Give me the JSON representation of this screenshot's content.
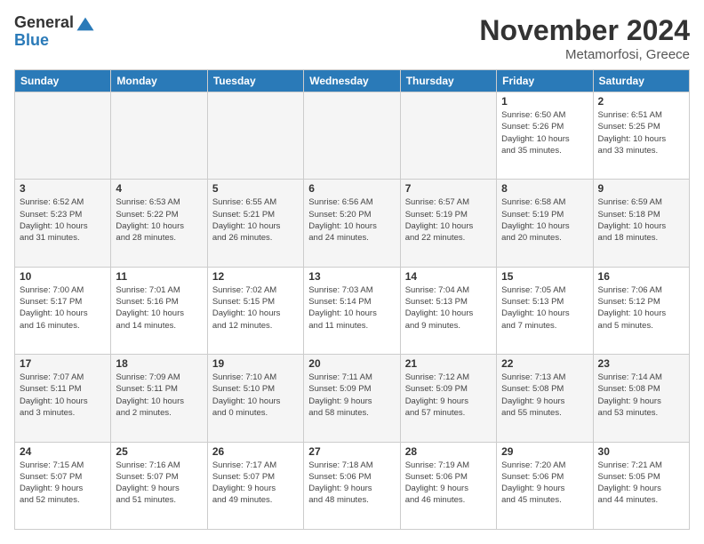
{
  "logo": {
    "general": "General",
    "blue": "Blue"
  },
  "header": {
    "month": "November 2024",
    "location": "Metamorfosi, Greece"
  },
  "weekdays": [
    "Sunday",
    "Monday",
    "Tuesday",
    "Wednesday",
    "Thursday",
    "Friday",
    "Saturday"
  ],
  "weeks": [
    [
      {
        "day": "",
        "info": ""
      },
      {
        "day": "",
        "info": ""
      },
      {
        "day": "",
        "info": ""
      },
      {
        "day": "",
        "info": ""
      },
      {
        "day": "",
        "info": ""
      },
      {
        "day": "1",
        "info": "Sunrise: 6:50 AM\nSunset: 5:26 PM\nDaylight: 10 hours\nand 35 minutes."
      },
      {
        "day": "2",
        "info": "Sunrise: 6:51 AM\nSunset: 5:25 PM\nDaylight: 10 hours\nand 33 minutes."
      }
    ],
    [
      {
        "day": "3",
        "info": "Sunrise: 6:52 AM\nSunset: 5:23 PM\nDaylight: 10 hours\nand 31 minutes."
      },
      {
        "day": "4",
        "info": "Sunrise: 6:53 AM\nSunset: 5:22 PM\nDaylight: 10 hours\nand 28 minutes."
      },
      {
        "day": "5",
        "info": "Sunrise: 6:55 AM\nSunset: 5:21 PM\nDaylight: 10 hours\nand 26 minutes."
      },
      {
        "day": "6",
        "info": "Sunrise: 6:56 AM\nSunset: 5:20 PM\nDaylight: 10 hours\nand 24 minutes."
      },
      {
        "day": "7",
        "info": "Sunrise: 6:57 AM\nSunset: 5:19 PM\nDaylight: 10 hours\nand 22 minutes."
      },
      {
        "day": "8",
        "info": "Sunrise: 6:58 AM\nSunset: 5:19 PM\nDaylight: 10 hours\nand 20 minutes."
      },
      {
        "day": "9",
        "info": "Sunrise: 6:59 AM\nSunset: 5:18 PM\nDaylight: 10 hours\nand 18 minutes."
      }
    ],
    [
      {
        "day": "10",
        "info": "Sunrise: 7:00 AM\nSunset: 5:17 PM\nDaylight: 10 hours\nand 16 minutes."
      },
      {
        "day": "11",
        "info": "Sunrise: 7:01 AM\nSunset: 5:16 PM\nDaylight: 10 hours\nand 14 minutes."
      },
      {
        "day": "12",
        "info": "Sunrise: 7:02 AM\nSunset: 5:15 PM\nDaylight: 10 hours\nand 12 minutes."
      },
      {
        "day": "13",
        "info": "Sunrise: 7:03 AM\nSunset: 5:14 PM\nDaylight: 10 hours\nand 11 minutes."
      },
      {
        "day": "14",
        "info": "Sunrise: 7:04 AM\nSunset: 5:13 PM\nDaylight: 10 hours\nand 9 minutes."
      },
      {
        "day": "15",
        "info": "Sunrise: 7:05 AM\nSunset: 5:13 PM\nDaylight: 10 hours\nand 7 minutes."
      },
      {
        "day": "16",
        "info": "Sunrise: 7:06 AM\nSunset: 5:12 PM\nDaylight: 10 hours\nand 5 minutes."
      }
    ],
    [
      {
        "day": "17",
        "info": "Sunrise: 7:07 AM\nSunset: 5:11 PM\nDaylight: 10 hours\nand 3 minutes."
      },
      {
        "day": "18",
        "info": "Sunrise: 7:09 AM\nSunset: 5:11 PM\nDaylight: 10 hours\nand 2 minutes."
      },
      {
        "day": "19",
        "info": "Sunrise: 7:10 AM\nSunset: 5:10 PM\nDaylight: 10 hours\nand 0 minutes."
      },
      {
        "day": "20",
        "info": "Sunrise: 7:11 AM\nSunset: 5:09 PM\nDaylight: 9 hours\nand 58 minutes."
      },
      {
        "day": "21",
        "info": "Sunrise: 7:12 AM\nSunset: 5:09 PM\nDaylight: 9 hours\nand 57 minutes."
      },
      {
        "day": "22",
        "info": "Sunrise: 7:13 AM\nSunset: 5:08 PM\nDaylight: 9 hours\nand 55 minutes."
      },
      {
        "day": "23",
        "info": "Sunrise: 7:14 AM\nSunset: 5:08 PM\nDaylight: 9 hours\nand 53 minutes."
      }
    ],
    [
      {
        "day": "24",
        "info": "Sunrise: 7:15 AM\nSunset: 5:07 PM\nDaylight: 9 hours\nand 52 minutes."
      },
      {
        "day": "25",
        "info": "Sunrise: 7:16 AM\nSunset: 5:07 PM\nDaylight: 9 hours\nand 51 minutes."
      },
      {
        "day": "26",
        "info": "Sunrise: 7:17 AM\nSunset: 5:07 PM\nDaylight: 9 hours\nand 49 minutes."
      },
      {
        "day": "27",
        "info": "Sunrise: 7:18 AM\nSunset: 5:06 PM\nDaylight: 9 hours\nand 48 minutes."
      },
      {
        "day": "28",
        "info": "Sunrise: 7:19 AM\nSunset: 5:06 PM\nDaylight: 9 hours\nand 46 minutes."
      },
      {
        "day": "29",
        "info": "Sunrise: 7:20 AM\nSunset: 5:06 PM\nDaylight: 9 hours\nand 45 minutes."
      },
      {
        "day": "30",
        "info": "Sunrise: 7:21 AM\nSunset: 5:05 PM\nDaylight: 9 hours\nand 44 minutes."
      }
    ]
  ]
}
